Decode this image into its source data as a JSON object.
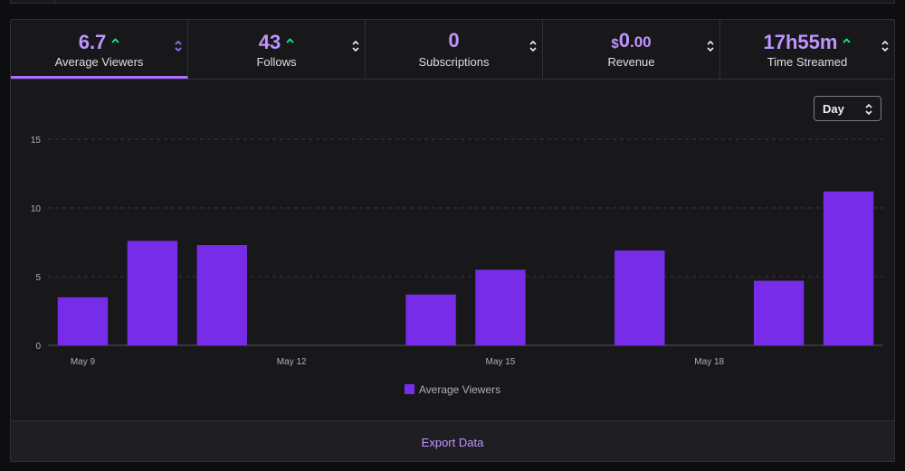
{
  "tabs": [
    {
      "id": "avg",
      "value": "6.7",
      "label": "Average Viewers",
      "trend": "up",
      "active": true
    },
    {
      "id": "follows",
      "value": "43",
      "label": "Follows",
      "trend": "up",
      "active": false
    },
    {
      "id": "subs",
      "value": "0",
      "label": "Subscriptions",
      "trend": "",
      "active": false
    },
    {
      "id": "revenue",
      "currency": "$",
      "value": "0",
      "cents": ".00",
      "label": "Revenue",
      "trend": "",
      "active": false
    },
    {
      "id": "time",
      "value": "17h55m",
      "label": "Time Streamed",
      "trend": "up",
      "active": false
    }
  ],
  "icons": {
    "trend": "arrow-up-icon",
    "sort": "sort-icon"
  },
  "colors": {
    "accent": "#a970ff",
    "bar": "#772ce8",
    "trend_up": "#00f593"
  },
  "range_select": {
    "value": "Day"
  },
  "chart_data": {
    "type": "bar",
    "categories": [
      "May 9",
      "May 10",
      "May 11",
      "May 12",
      "May 13",
      "May 14",
      "May 15",
      "May 16",
      "May 17",
      "May 18",
      "May 19",
      "May 20"
    ],
    "tick_labels": [
      "May 9",
      "May 12",
      "May 15",
      "May 18"
    ],
    "series": [
      {
        "name": "Average Viewers",
        "values": [
          3.5,
          7.6,
          7.3,
          0,
          0,
          3.7,
          5.5,
          0,
          6.9,
          0,
          4.7,
          11.2
        ]
      }
    ],
    "yticks": [
      0,
      5,
      10,
      15
    ],
    "ylim": [
      0,
      15
    ],
    "grid": true,
    "legend": "bottom"
  },
  "footer": {
    "export_label": "Export Data"
  }
}
